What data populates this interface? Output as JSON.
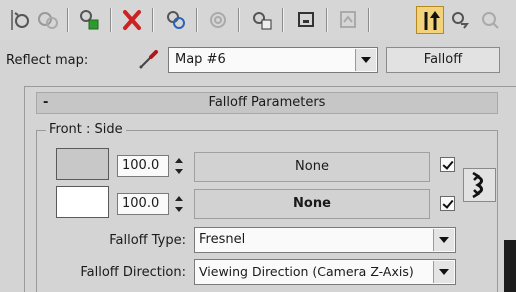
{
  "toolbar": {
    "buttons": [
      {
        "name": "get-material-icon"
      },
      {
        "name": "put-to-scene-icon"
      },
      {
        "name": "assign-to-selection-icon"
      },
      {
        "name": "reset-map-icon"
      },
      {
        "name": "make-unique-icon"
      },
      {
        "name": "put-to-library-icon"
      },
      {
        "name": "material-id-channel-icon"
      },
      {
        "name": "show-map-in-viewport-icon"
      },
      {
        "name": "show-end-result-icon"
      },
      {
        "name": "go-to-parent-icon"
      },
      {
        "name": "go-forward-to-sibling-icon"
      },
      {
        "name": "options-icon"
      }
    ],
    "active_color": "#f2d27a"
  },
  "reflect": {
    "label": "Reflect map:",
    "map_name": "Map #6",
    "map_type_button": "Falloff"
  },
  "rollout": {
    "collapse_symbol": "-",
    "title": "Falloff Parameters",
    "group_title": "Front : Side",
    "front": {
      "color": "#c8c8c8",
      "amount": "100.0",
      "map_label": "None",
      "map_enabled": true
    },
    "side": {
      "color": "#ffffff",
      "amount": "100.0",
      "map_label": "None",
      "map_enabled": true
    },
    "falloff_type_label": "Falloff Type:",
    "falloff_type_value": "Fresnel",
    "falloff_direction_label": "Falloff Direction:",
    "falloff_direction_value": "Viewing Direction (Camera Z-Axis)"
  }
}
